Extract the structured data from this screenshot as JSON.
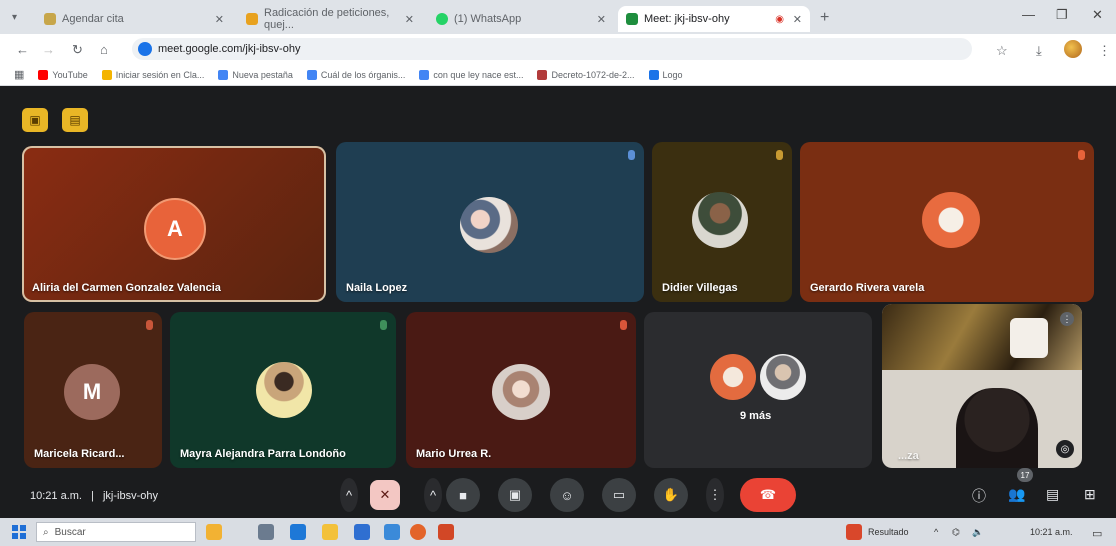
{
  "browser": {
    "tabs": [
      {
        "title": "Agendar cita",
        "active": false,
        "favicon_color": "#c7a64a"
      },
      {
        "title": "Radicación de peticiones, quej...",
        "active": false,
        "favicon_color": "#e8a21f"
      },
      {
        "title": "(1) WhatsApp",
        "active": false,
        "favicon_color": "#25d366"
      },
      {
        "title": "Meet: jkj-ibsv-ohy",
        "active": true,
        "favicon_color": "#1e8e3e"
      }
    ],
    "address": "meet.google.com/jkj-ibsv-ohy",
    "bookmarks": [
      {
        "label": "YouTube",
        "color": "#ff0000"
      },
      {
        "label": "Iniciar sesión en Cla...",
        "color": "#f4b400"
      },
      {
        "label": "Nueva pestaña",
        "color": "#4285f4"
      },
      {
        "label": "Cuál de los órganis...",
        "color": "#4285f4"
      },
      {
        "label": "con que ley nace est...",
        "color": "#4285f4"
      },
      {
        "label": "Decreto-1072-de-2...",
        "color": "#b23b3b"
      },
      {
        "label": "Logo",
        "color": "#1a73e8"
      }
    ]
  },
  "meet": {
    "meeting_code": "jkj-ibsv-ohy",
    "time": "10:21 a.m.",
    "separator": "|",
    "participant_count": "17",
    "participants": [
      {
        "name": "Aliria del Carmen Gonzalez Valencia",
        "initial": "A",
        "avatar_color": "#e8633a"
      },
      {
        "name": "Naila Lopez"
      },
      {
        "name": "Didier Villegas"
      },
      {
        "name": "Gerardo Rivera varela"
      },
      {
        "name": "Maricela Ricard...",
        "initial": "M",
        "avatar_color": "#9c6a5d"
      },
      {
        "name": "Mayra Alejandra Parra Londoño"
      },
      {
        "name": "Mario Urrea R."
      },
      {
        "name": "9 más"
      },
      {
        "name": "...za"
      }
    ]
  },
  "taskbar": {
    "search_placeholder": "Buscar",
    "weather_label": "Resultado",
    "clock": "10:21 a.m."
  }
}
